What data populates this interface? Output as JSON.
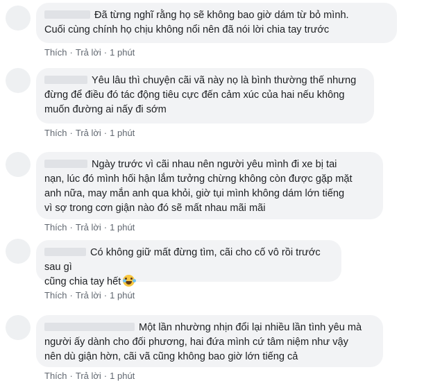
{
  "comments": [
    {
      "text_lines": [
        "Đã từng nghĩ rằng họ sẽ không bao giờ dám từ bỏ mình.",
        "Cuối cùng chính họ chịu không nổi nên đã nói lời chia tay trước"
      ],
      "like_label": "Thích",
      "reply_label": "Trả lời",
      "time": "1 phút"
    },
    {
      "text_lines": [
        "Yêu lâu thì chuyện cãi vã này nọ là bình thường thế nhưng",
        "đừng để điều đó tác động tiêu cực đến cảm xúc của hai nếu không",
        "muốn đường ai nấy đi sớm"
      ],
      "like_label": "Thích",
      "reply_label": "Trả lời",
      "time": "1 phút"
    },
    {
      "text_lines": [
        "Ngày trước vì cãi nhau nên người yêu mình đi xe bị tai",
        "nạn, lúc đó mình hối hận lắm tưởng chừng không còn được gặp mặt",
        "anh nữa, may mắn anh qua khỏi, giờ tụi mình không dám lớn tiếng",
        "vì sợ trong cơn giận nào đó sẽ mất nhau mãi mãi"
      ],
      "like_label": "Thích",
      "reply_label": "Trả lời",
      "time": "1 phút"
    },
    {
      "text_lines": [
        "Có không giữ mất đừng tìm, cãi cho cố vô rồi trước sau gì",
        "cũng chia tay hết"
      ],
      "emoji": "laughing-tears-emoji",
      "like_label": "Thích",
      "reply_label": "Trả lời",
      "time": "1 phút"
    },
    {
      "text_lines": [
        "Một lần nhường nhịn đổi lại nhiều lần tình yêu mà",
        "người ấy dành cho đối phương, hai đứa mình cứ tâm niệm như vậy",
        "nên dù giận hờn, cãi vã cũng không bao giờ lớn tiếng cả"
      ],
      "like_label": "Thích",
      "reply_label": "Trả lời",
      "time": "1 phút"
    }
  ],
  "separator": "·"
}
